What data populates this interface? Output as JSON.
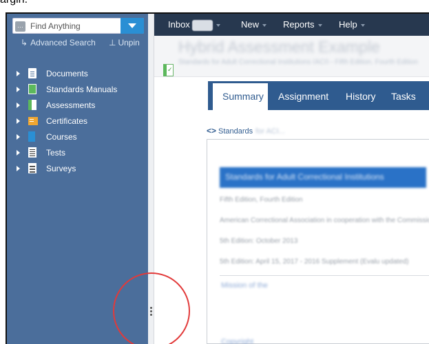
{
  "caption": {
    "text": "argin."
  },
  "search": {
    "placeholder": "Find Anything"
  },
  "sidebar": {
    "advanced_search": "Advanced Search",
    "unpin": "Unpin",
    "items": [
      {
        "label": "Documents",
        "icon": "document-icon"
      },
      {
        "label": "Standards Manuals",
        "icon": "manual-icon"
      },
      {
        "label": "Assessments",
        "icon": "assessment-icon"
      },
      {
        "label": "Certificates",
        "icon": "certificate-icon"
      },
      {
        "label": "Courses",
        "icon": "course-icon"
      },
      {
        "label": "Tests",
        "icon": "test-icon"
      },
      {
        "label": "Surveys",
        "icon": "survey-icon"
      }
    ]
  },
  "topbar": {
    "inbox": "Inbox",
    "new": "New",
    "reports": "Reports",
    "help": "Help"
  },
  "page": {
    "title": "Hybrid Assessment Example",
    "subtitle": "Standards for Adult Correctional Institutions (ACI) - Fifth Edition, Fourth Edition"
  },
  "tabs": [
    "Summary",
    "Assignment",
    "History",
    "Tasks"
  ],
  "breadcrumb": {
    "label": "Standards",
    "rest": "for ACI..."
  },
  "document": {
    "title": "Standards for Adult Correctional Institutions",
    "lines": [
      "Fifth Edition, Fourth Edition",
      "American Correctional Association in cooperation with the Commission",
      "5th Edition: October 2013",
      "5th Edition: April 15, 2017 - 2016 Supplement (Evalu updated)"
    ],
    "links": [
      "Mission of the",
      "Copyright"
    ]
  },
  "colors": {
    "sidebar": "#4b6e9b",
    "topbar": "#27384f",
    "tabs": "#2f5b8f",
    "accent": "#2a8fd4",
    "annotation": "#e23a3a"
  }
}
